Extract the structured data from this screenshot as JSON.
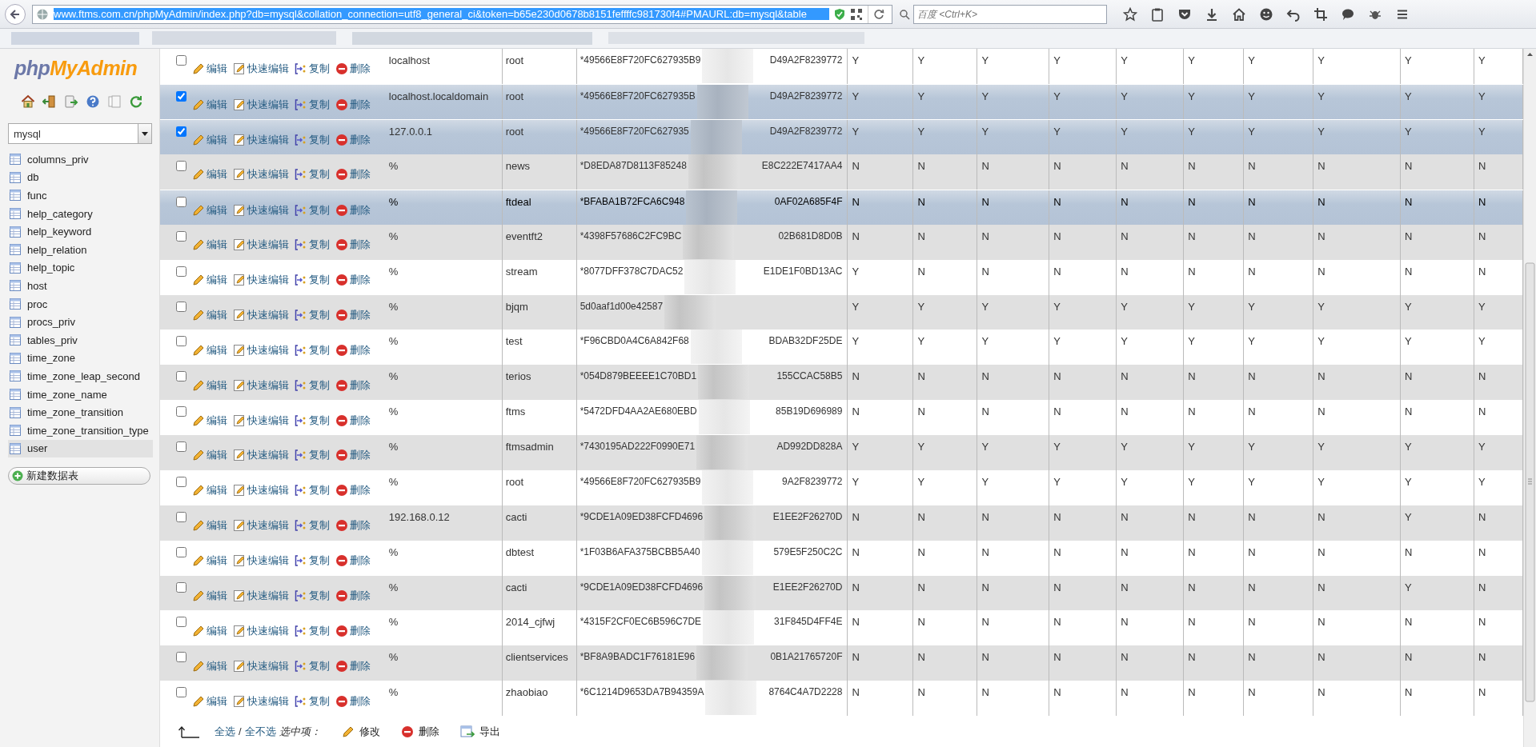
{
  "browser": {
    "url": {
      "text": "www.ftms.com.cn/phpMyAdmin/index.php?db=mysql&collation_connection=utf8_general_ci&token=b65e230d0678b8151feffffc981730f4#PMAURL:db=mysql&table",
      "selected": true
    },
    "search": {
      "placeholder": "百度 <Ctrl+K>"
    }
  },
  "sidebar": {
    "logo": {
      "part_1": "php",
      "part_2": "MyAdmin"
    },
    "database": "mysql",
    "tables": [
      {
        "name": "columns_priv",
        "selected": false
      },
      {
        "name": "db",
        "selected": false
      },
      {
        "name": "func",
        "selected": false
      },
      {
        "name": "help_category",
        "selected": false
      },
      {
        "name": "help_keyword",
        "selected": false
      },
      {
        "name": "help_relation",
        "selected": false
      },
      {
        "name": "help_topic",
        "selected": false
      },
      {
        "name": "host",
        "selected": false
      },
      {
        "name": "proc",
        "selected": false
      },
      {
        "name": "procs_priv",
        "selected": false
      },
      {
        "name": "tables_priv",
        "selected": false
      },
      {
        "name": "time_zone",
        "selected": false
      },
      {
        "name": "time_zone_leap_second",
        "selected": false
      },
      {
        "name": "time_zone_name",
        "selected": false
      },
      {
        "name": "time_zone_transition",
        "selected": false
      },
      {
        "name": "time_zone_transition_type",
        "selected": false
      },
      {
        "name": "user",
        "selected": true
      }
    ],
    "new_table_button": "新建数据表"
  },
  "table": {
    "rows": [
      {
        "checked": false,
        "hovered": false,
        "actions": [
          "编辑",
          "快速编辑",
          "复制",
          "删除"
        ],
        "host": "localhost",
        "user": "root",
        "password_start": "*49566E8F720FC627935B9",
        "password_end": "D49A2F8239772",
        "privileges": [
          "Y",
          "Y",
          "Y",
          "Y",
          "Y",
          "Y",
          "Y",
          "Y",
          "Y",
          "Y"
        ]
      },
      {
        "checked": true,
        "hovered": false,
        "actions": [
          "编辑",
          "快速编辑",
          "复制",
          "删除"
        ],
        "host": "localhost.localdomain",
        "user": "root",
        "password_start": "*49566E8F720FC627935B",
        "password_end": "D49A2F8239772",
        "privileges": [
          "Y",
          "Y",
          "Y",
          "Y",
          "Y",
          "Y",
          "Y",
          "Y",
          "Y",
          "Y"
        ]
      },
      {
        "checked": true,
        "hovered": false,
        "actions": [
          "编辑",
          "快速编辑",
          "复制",
          "删除"
        ],
        "host": "127.0.0.1",
        "user": "root",
        "password_start": "*49566E8F720FC627935",
        "password_end": "D49A2F8239772",
        "privileges": [
          "Y",
          "Y",
          "Y",
          "Y",
          "Y",
          "Y",
          "Y",
          "Y",
          "Y",
          "Y"
        ]
      },
      {
        "checked": false,
        "hovered": false,
        "actions": [
          "编辑",
          "快速编辑",
          "复制",
          "删除"
        ],
        "host": "%",
        "user": "news",
        "password_start": "*D8EDA87D8113F85248",
        "password_end": "E8C222E7417AA4",
        "privileges": [
          "N",
          "N",
          "N",
          "N",
          "N",
          "N",
          "N",
          "N",
          "N",
          "N"
        ]
      },
      {
        "checked": false,
        "hovered": true,
        "actions": [
          "编辑",
          "快速编辑",
          "复制",
          "删除"
        ],
        "host": "%",
        "user": "ftdeal",
        "password_start": "*BFABA1B72FCA6C948",
        "password_end": "0AF02A685F4F",
        "privileges": [
          "N",
          "N",
          "N",
          "N",
          "N",
          "N",
          "N",
          "N",
          "N",
          "N"
        ]
      },
      {
        "checked": false,
        "hovered": false,
        "actions": [
          "编辑",
          "快速编辑",
          "复制",
          "删除"
        ],
        "host": "%",
        "user": "eventft2",
        "password_start": "*4398F57686C2FC9BC",
        "password_end": "02B681D8D0B",
        "privileges": [
          "N",
          "N",
          "N",
          "N",
          "N",
          "N",
          "N",
          "N",
          "N",
          "N"
        ]
      },
      {
        "checked": false,
        "hovered": false,
        "actions": [
          "编辑",
          "快速编辑",
          "复制",
          "删除"
        ],
        "host": "%",
        "user": "stream",
        "password_start": "*8077DFF378C7DAC52",
        "password_end": "E1DE1F0BD13AC",
        "privileges": [
          "Y",
          "N",
          "N",
          "N",
          "N",
          "N",
          "N",
          "N",
          "N",
          "N"
        ]
      },
      {
        "checked": false,
        "hovered": false,
        "actions": [
          "编辑",
          "快速编辑",
          "复制",
          "删除"
        ],
        "host": "%",
        "user": "bjqm",
        "password_start": "5d0aaf1d00e42587",
        "privileges": [
          "Y",
          "Y",
          "Y",
          "Y",
          "Y",
          "Y",
          "Y",
          "Y",
          "Y",
          "Y"
        ]
      },
      {
        "checked": false,
        "hovered": false,
        "actions": [
          "编辑",
          "快速编辑",
          "复制",
          "删除"
        ],
        "host": "%",
        "user": "test",
        "password_start": "*F96CBD0A4C6A842F68",
        "password_end": "BDAB32DF25DE",
        "privileges": [
          "Y",
          "Y",
          "Y",
          "Y",
          "Y",
          "Y",
          "Y",
          "Y",
          "Y",
          "Y"
        ]
      },
      {
        "checked": false,
        "hovered": false,
        "actions": [
          "编辑",
          "快速编辑",
          "复制",
          "删除"
        ],
        "host": "%",
        "user": "terios",
        "password_start": "*054D879BEEEE1C70BD1",
        "password_end": "155CCAC58B5",
        "privileges": [
          "N",
          "N",
          "N",
          "N",
          "N",
          "N",
          "N",
          "N",
          "N",
          "N"
        ]
      },
      {
        "checked": false,
        "hovered": false,
        "actions": [
          "编辑",
          "快速编辑",
          "复制",
          "删除"
        ],
        "host": "%",
        "user": "ftms",
        "password_start": "*5472DFD4AA2AE680EBD",
        "password_end": "85B19D696989",
        "privileges": [
          "N",
          "N",
          "N",
          "N",
          "N",
          "N",
          "N",
          "N",
          "N",
          "N"
        ]
      },
      {
        "checked": false,
        "hovered": false,
        "actions": [
          "编辑",
          "快速编辑",
          "复制",
          "删除"
        ],
        "host": "%",
        "user": "ftmsadmin",
        "password_start": "*7430195AD222F0990E71",
        "password_end": "AD992DD828A",
        "privileges": [
          "Y",
          "Y",
          "Y",
          "Y",
          "Y",
          "Y",
          "Y",
          "Y",
          "Y",
          "Y"
        ]
      },
      {
        "checked": false,
        "hovered": false,
        "actions": [
          "编辑",
          "快速编辑",
          "复制",
          "删除"
        ],
        "host": "%",
        "user": "root",
        "password_start": "*49566E8F720FC627935B9",
        "password_end": "9A2F8239772",
        "privileges": [
          "Y",
          "Y",
          "Y",
          "Y",
          "Y",
          "Y",
          "Y",
          "Y",
          "Y",
          "Y"
        ]
      },
      {
        "checked": false,
        "hovered": false,
        "actions": [
          "编辑",
          "快速编辑",
          "复制",
          "删除"
        ],
        "host": "192.168.0.12",
        "user": "cacti",
        "password_start": "*9CDE1A09ED38FCFD4696",
        "password_end": "E1EE2F26270D",
        "privileges": [
          "N",
          "N",
          "N",
          "N",
          "N",
          "N",
          "N",
          "N",
          "Y",
          "N"
        ]
      },
      {
        "checked": false,
        "hovered": false,
        "actions": [
          "编辑",
          "快速编辑",
          "复制",
          "删除"
        ],
        "host": "%",
        "user": "dbtest",
        "password_start": "*1F03B6AFA375BCBB5A40",
        "password_end": "579E5F250C2C",
        "privileges": [
          "N",
          "N",
          "N",
          "N",
          "N",
          "N",
          "N",
          "N",
          "N",
          "N"
        ]
      },
      {
        "checked": false,
        "hovered": false,
        "actions": [
          "编辑",
          "快速编辑",
          "复制",
          "删除"
        ],
        "host": "%",
        "user": "cacti",
        "password_start": "*9CDE1A09ED38FCFD4696",
        "password_end": "E1EE2F26270D",
        "privileges": [
          "N",
          "N",
          "N",
          "N",
          "N",
          "N",
          "N",
          "N",
          "Y",
          "N"
        ]
      },
      {
        "checked": false,
        "hovered": false,
        "actions": [
          "编辑",
          "快速编辑",
          "复制",
          "删除"
        ],
        "host": "%",
        "user": "2014_cjfwj",
        "password_start": "*4315F2CF0EC6B596C7DE",
        "password_end": "31F845D4FF4E",
        "privileges": [
          "N",
          "N",
          "N",
          "N",
          "N",
          "N",
          "N",
          "N",
          "N",
          "N"
        ]
      },
      {
        "checked": false,
        "hovered": false,
        "actions": [
          "编辑",
          "快速编辑",
          "复制",
          "删除"
        ],
        "host": "%",
        "user": "clientservices",
        "password_start": "*BF8A9BADC1F76181E96",
        "password_end": "0B1A21765720F",
        "privileges": [
          "N",
          "N",
          "N",
          "N",
          "N",
          "N",
          "N",
          "N",
          "N",
          "N"
        ]
      },
      {
        "checked": false,
        "hovered": false,
        "actions": [
          "编辑",
          "快速编辑",
          "复制",
          "删除"
        ],
        "host": "%",
        "user": "zhaobiao",
        "password_start": "*6C1214D9653DA7B94359A",
        "password_end": "8764C4A7D2228",
        "privileges": [
          "N",
          "N",
          "N",
          "N",
          "N",
          "N",
          "N",
          "N",
          "N",
          "N"
        ]
      }
    ]
  },
  "bulk_bar": {
    "select_all": "全选",
    "separator": "/",
    "select_none": "全不选",
    "with_selected": "选中项：",
    "buttons": [
      "修改",
      "删除",
      "导出"
    ]
  }
}
